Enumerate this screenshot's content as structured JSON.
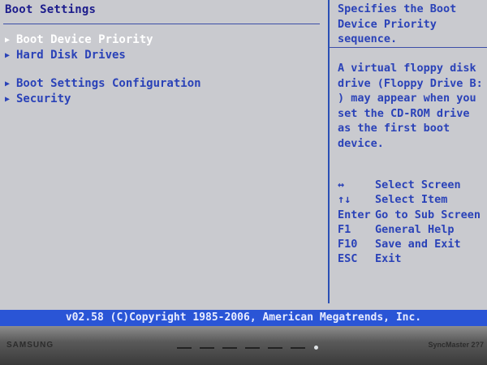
{
  "main": {
    "title": "Boot Settings",
    "items": [
      {
        "label": "Boot Device Priority",
        "selected": true
      },
      {
        "label": "Hard Disk Drives",
        "selected": false
      },
      {
        "label": "Boot Settings Configuration",
        "selected": false
      },
      {
        "label": "Security",
        "selected": false
      }
    ]
  },
  "help": {
    "description": "Specifies the Boot\nDevice Priority\nsequence.",
    "note": "A virtual floppy disk\ndrive (Floppy Drive B:\n) may appear when you\nset the CD-ROM drive\nas the first boot\ndevice.",
    "keys": [
      {
        "key": "↔",
        "action": "Select Screen"
      },
      {
        "key": "↑↓",
        "action": "Select Item"
      },
      {
        "key": "Enter",
        "action": "Go to Sub Screen"
      },
      {
        "key": "F1",
        "action": "General Help"
      },
      {
        "key": "F10",
        "action": "Save and Exit"
      },
      {
        "key": "ESC",
        "action": "Exit"
      }
    ]
  },
  "footer": {
    "copyright": "v02.58 (C)Copyright 1985-2006, American Megatrends, Inc."
  },
  "monitor": {
    "brand": "SAMSUNG",
    "model": "SyncMaster 2?7"
  },
  "colors": {
    "screen_bg": "#c9cacf",
    "text_blue": "#2a42b8",
    "title_navy": "#1c1c8c",
    "selected": "#ffffff",
    "footer_bg": "#2a55d6"
  }
}
